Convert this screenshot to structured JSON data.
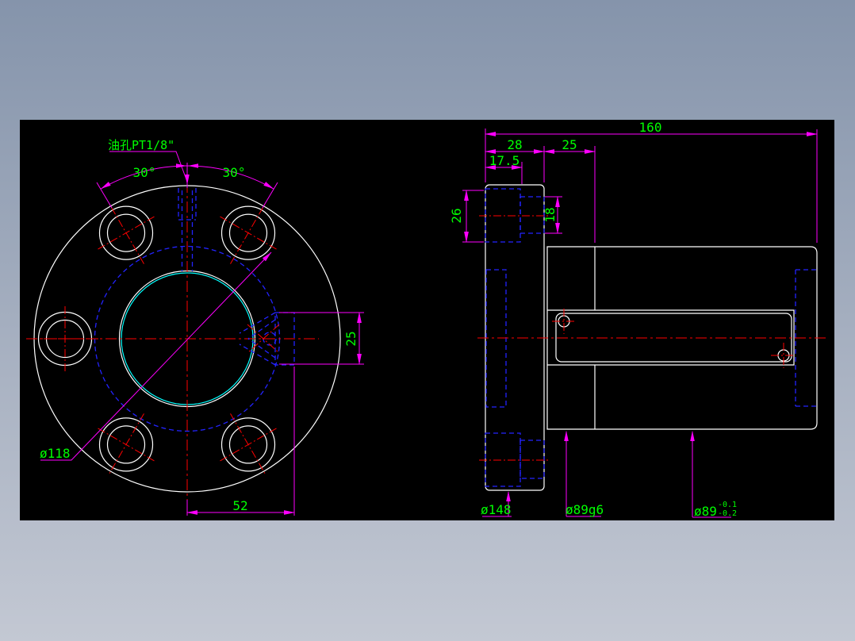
{
  "app": {
    "description": "CAD technical drawing viewer showing a ballscrew support flange unit, front view and side section view"
  },
  "colors": {
    "background_top": "#8594ab",
    "background_bottom": "#c3c8d3",
    "canvas": "#000000",
    "outline": "#ffffff",
    "hidden_line": "#2323ff",
    "centerline": "#ff0000",
    "dimension": "#ff00ff",
    "label_text": "#00ff00",
    "bore_highlight": "#00ffff"
  },
  "front_view": {
    "labels": {
      "oil_hole_note": "油孔PT1/8\"",
      "angle_left": "30°",
      "angle_right": "30°",
      "bolt_circle_dia": "ø118",
      "keyway_width": "25",
      "keyway_offset": "52"
    }
  },
  "side_view": {
    "labels": {
      "overall_length": "160",
      "flange_thickness": "28",
      "hub_length": "25",
      "counterbore_depth": "17.5",
      "counterbore_dia": "26",
      "bolt_hole_dia": "18",
      "flange_dia": "ø148",
      "body_fit_dia": "ø89g6",
      "body_dia": "ø89",
      "tolerance_upper": "-0.1",
      "tolerance_lower": "-0.2"
    }
  }
}
